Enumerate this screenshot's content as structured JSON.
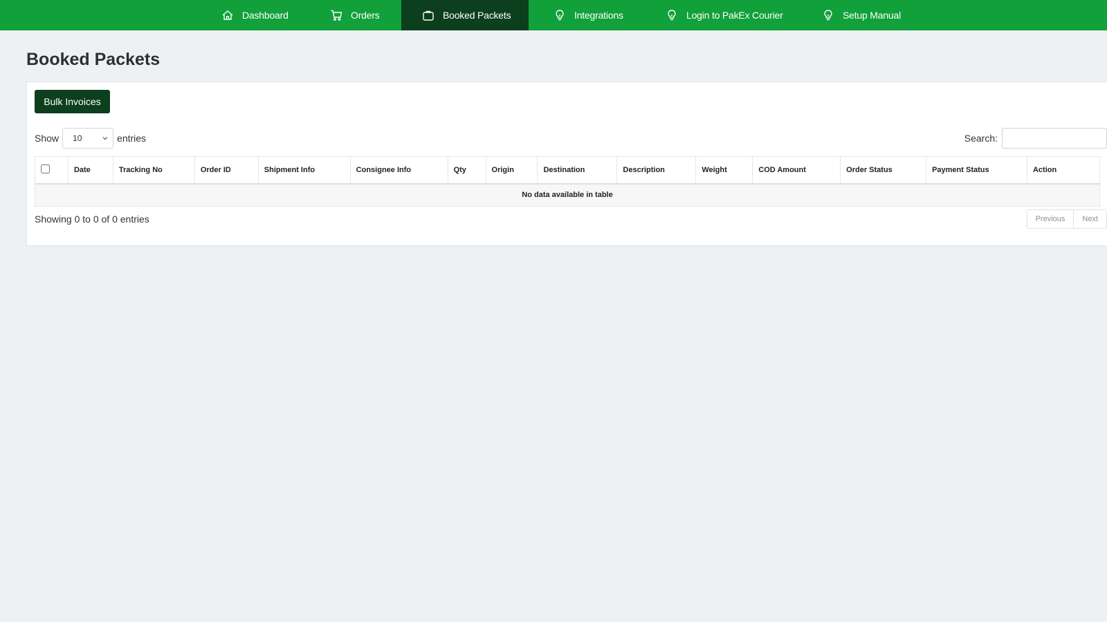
{
  "nav": {
    "items": [
      {
        "label": "Dashboard",
        "icon": "home-icon"
      },
      {
        "label": "Orders",
        "icon": "cart-icon"
      },
      {
        "label": "Booked Packets",
        "icon": "bag-icon",
        "active": true
      },
      {
        "label": "Integrations",
        "icon": "lightbulb-icon"
      },
      {
        "label": "Login to PakEx Courier",
        "icon": "lightbulb-icon"
      },
      {
        "label": "Setup Manual",
        "icon": "lightbulb-icon"
      }
    ]
  },
  "page": {
    "title": "Booked Packets"
  },
  "toolbar": {
    "bulk_invoices_label": "Bulk Invoices"
  },
  "length": {
    "show_label": "Show",
    "value": "10",
    "entries_label": "entries"
  },
  "search": {
    "label": "Search:",
    "value": ""
  },
  "table": {
    "columns": [
      "Date",
      "Tracking No",
      "Order ID",
      "Shipment Info",
      "Consignee Info",
      "Qty",
      "Origin",
      "Destination",
      "Description",
      "Weight",
      "COD Amount",
      "Order Status",
      "Payment Status",
      "Action"
    ],
    "empty_message": "No data available in table"
  },
  "footer": {
    "info": "Showing 0 to 0 of 0 entries",
    "previous_label": "Previous",
    "next_label": "Next"
  },
  "colors": {
    "nav_bg": "#11a03a",
    "nav_active": "#0c3f1e",
    "button_bg": "#0c3f1e"
  }
}
